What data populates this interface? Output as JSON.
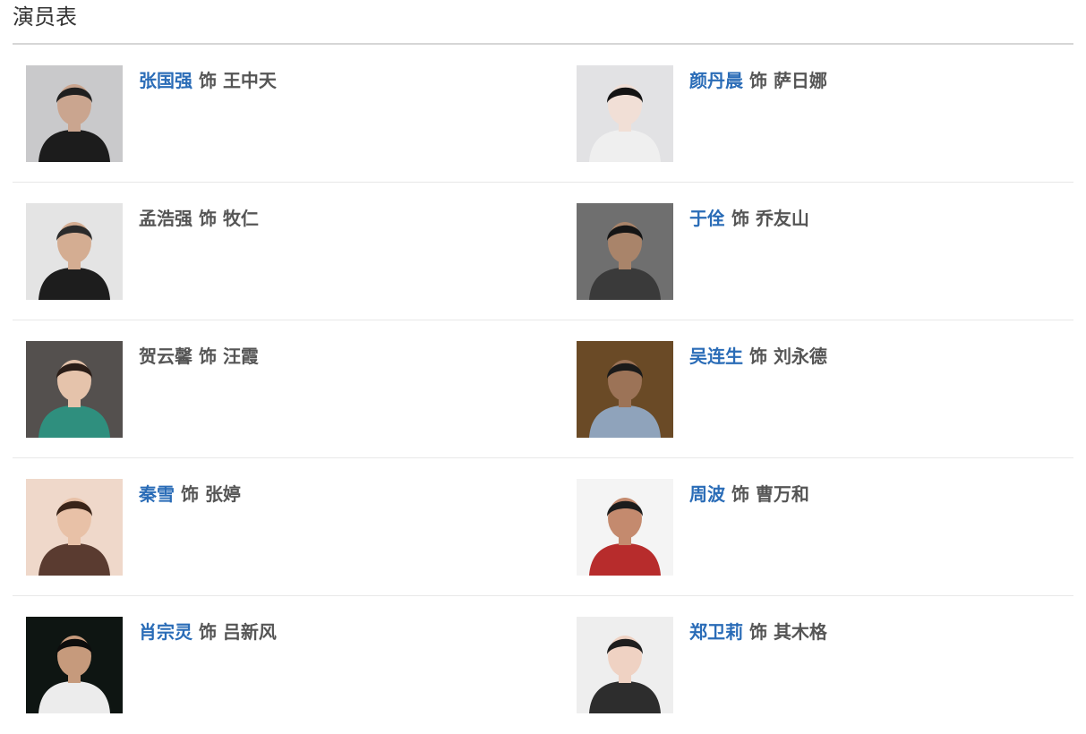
{
  "section": {
    "title": "演员表"
  },
  "cast_rows": [
    [
      {
        "actor": "张国强",
        "as": "饰",
        "role": "王中天",
        "linked": true,
        "photo": {
          "bg": "#c9c9cb",
          "skin": "#caa58f",
          "hair": "#1f1f1f",
          "shirt": "#1c1c1c"
        }
      },
      {
        "actor": "颜丹晨",
        "as": "饰",
        "role": "萨日娜",
        "linked": true,
        "photo": {
          "bg": "#e2e2e4",
          "skin": "#f1dfd6",
          "hair": "#141414",
          "shirt": "#efefef"
        }
      }
    ],
    [
      {
        "actor": "孟浩强",
        "as": "饰",
        "role": "牧仁",
        "linked": false,
        "photo": {
          "bg": "#e4e4e4",
          "skin": "#d4ad92",
          "hair": "#2b2b2b",
          "shirt": "#1d1d1d"
        }
      },
      {
        "actor": "于佺",
        "as": "饰",
        "role": "乔友山",
        "linked": true,
        "photo": {
          "bg": "#6f6f6f",
          "skin": "#a9846a",
          "hair": "#151515",
          "shirt": "#3a3a3a"
        }
      }
    ],
    [
      {
        "actor": "贺云馨",
        "as": "饰",
        "role": "汪霞",
        "linked": false,
        "photo": {
          "bg": "#54504e",
          "skin": "#e5c3ab",
          "hair": "#2a1d17",
          "shirt": "#2f8f7e"
        }
      },
      {
        "actor": "吴连生",
        "as": "饰",
        "role": "刘永德",
        "linked": true,
        "photo": {
          "bg": "#6a4a26",
          "skin": "#9c7357",
          "hair": "#1a1a1a",
          "shirt": "#8fa3bb"
        }
      }
    ],
    [
      {
        "actor": "秦雪",
        "as": "饰",
        "role": "张婷",
        "linked": true,
        "photo": {
          "bg": "#efd8ca",
          "skin": "#e8c1a7",
          "hair": "#3a2418",
          "shirt": "#5a3b30"
        }
      },
      {
        "actor": "周波",
        "as": "饰",
        "role": "曹万和",
        "linked": true,
        "photo": {
          "bg": "#f4f4f4",
          "skin": "#c48a6e",
          "hair": "#1c1c1c",
          "shirt": "#b72c2c"
        }
      }
    ],
    [
      {
        "actor": "肖宗灵",
        "as": "饰",
        "role": "吕新风",
        "linked": true,
        "photo": {
          "bg": "#0e1512",
          "skin": "#c69a7c",
          "hair": "#0d0d0d",
          "shirt": "#ececec"
        }
      },
      {
        "actor": "郑卫莉",
        "as": "饰",
        "role": "其木格",
        "linked": true,
        "photo": {
          "bg": "#eeeeee",
          "skin": "#efd2c3",
          "hair": "#1e1e1e",
          "shirt": "#2d2d2d"
        }
      }
    ]
  ]
}
